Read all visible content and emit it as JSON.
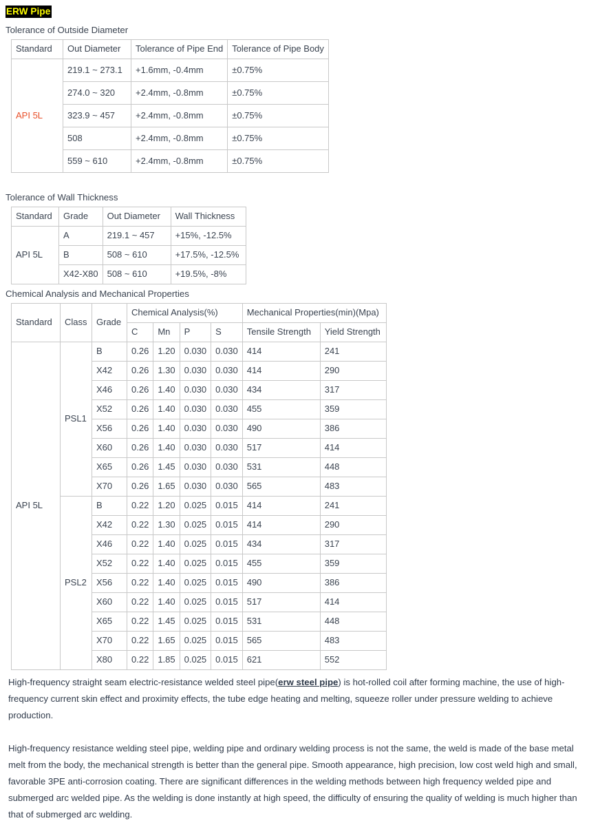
{
  "document": {
    "title": "ERW Pipe",
    "title_colors": {
      "background": "#000000",
      "text": "#ffff00"
    },
    "accent_red": "#e8502a"
  },
  "sections": {
    "outside_diameter": {
      "caption": "Tolerance of Outside Diameter",
      "columns": [
        "Standard",
        "Out Diameter",
        "Tolerance of Pipe End",
        "Tolerance of Pipe Body"
      ],
      "standard": "API 5L",
      "rows": [
        {
          "out_diameter": "219.1 ~ 273.1",
          "pipe_end": "+1.6mm, -0.4mm",
          "pipe_body": "±0.75%"
        },
        {
          "out_diameter": "274.0 ~ 320",
          "pipe_end": "+2.4mm, -0.8mm",
          "pipe_body": "±0.75%"
        },
        {
          "out_diameter": "323.9 ~ 457",
          "pipe_end": "+2.4mm, -0.8mm",
          "pipe_body": "±0.75%"
        },
        {
          "out_diameter": "508",
          "pipe_end": "+2.4mm, -0.8mm",
          "pipe_body": "±0.75%"
        },
        {
          "out_diameter": "559 ~ 610",
          "pipe_end": "+2.4mm, -0.8mm",
          "pipe_body": "±0.75%"
        }
      ]
    },
    "wall_thickness": {
      "caption": "Tolerance of Wall Thickness",
      "columns": [
        "Standard",
        "Grade",
        "Out Diameter",
        "Wall Thickness"
      ],
      "standard": "API 5L",
      "rows": [
        {
          "grade": "A",
          "out_diameter": "219.1 ~ 457",
          "wall_thickness": "+15%, -12.5%"
        },
        {
          "grade": "B",
          "out_diameter": "508 ~ 610",
          "wall_thickness": "+17.5%, -12.5%"
        },
        {
          "grade": "X42-X80",
          "out_diameter": "508 ~ 610",
          "wall_thickness": "+19.5%, -8%"
        }
      ]
    },
    "chem_mech": {
      "caption": "Chemical Analysis and Mechanical Properties",
      "col_standard": "Standard",
      "col_class": "Class",
      "col_grade": "Grade",
      "group_chemical": "Chemical Analysis(%)",
      "group_mechanical": "Mechanical Properties(min)(Mpa)",
      "sub_c": "C",
      "sub_mn": "Mn",
      "sub_p": "P",
      "sub_s": "S",
      "sub_tensile": "Tensile Strength",
      "sub_yield": "Yield Strength",
      "standard": "API 5L",
      "classes": [
        {
          "name": "PSL1",
          "rows": [
            {
              "grade": "B",
              "c": "0.26",
              "mn": "1.20",
              "p": "0.030",
              "s": "0.030",
              "tensile": "414",
              "yield": "241"
            },
            {
              "grade": "X42",
              "c": "0.26",
              "mn": "1.30",
              "p": "0.030",
              "s": "0.030",
              "tensile": "414",
              "yield": "290"
            },
            {
              "grade": "X46",
              "c": "0.26",
              "mn": "1.40",
              "p": "0.030",
              "s": "0.030",
              "tensile": "434",
              "yield": "317"
            },
            {
              "grade": "X52",
              "c": "0.26",
              "mn": "1.40",
              "p": "0.030",
              "s": "0.030",
              "tensile": "455",
              "yield": "359"
            },
            {
              "grade": "X56",
              "c": "0.26",
              "mn": "1.40",
              "p": "0.030",
              "s": "0.030",
              "tensile": "490",
              "yield": "386"
            },
            {
              "grade": "X60",
              "c": "0.26",
              "mn": "1.40",
              "p": "0.030",
              "s": "0.030",
              "tensile": "517",
              "yield": "414"
            },
            {
              "grade": "X65",
              "c": "0.26",
              "mn": "1.45",
              "p": "0.030",
              "s": "0.030",
              "tensile": "531",
              "yield": "448"
            },
            {
              "grade": "X70",
              "c": "0.26",
              "mn": "1.65",
              "p": "0.030",
              "s": "0.030",
              "tensile": "565",
              "yield": "483"
            }
          ]
        },
        {
          "name": "PSL2",
          "rows": [
            {
              "grade": "B",
              "c": "0.22",
              "mn": "1.20",
              "p": "0.025",
              "s": "0.015",
              "tensile": "414",
              "yield": "241"
            },
            {
              "grade": "X42",
              "c": "0.22",
              "mn": "1.30",
              "p": "0.025",
              "s": "0.015",
              "tensile": "414",
              "yield": "290"
            },
            {
              "grade": "X46",
              "c": "0.22",
              "mn": "1.40",
              "p": "0.025",
              "s": "0.015",
              "tensile": "434",
              "yield": "317"
            },
            {
              "grade": "X52",
              "c": "0.22",
              "mn": "1.40",
              "p": "0.025",
              "s": "0.015",
              "tensile": "455",
              "yield": "359"
            },
            {
              "grade": "X56",
              "c": "0.22",
              "mn": "1.40",
              "p": "0.025",
              "s": "0.015",
              "tensile": "490",
              "yield": "386"
            },
            {
              "grade": "X60",
              "c": "0.22",
              "mn": "1.40",
              "p": "0.025",
              "s": "0.015",
              "tensile": "517",
              "yield": "414"
            },
            {
              "grade": "X65",
              "c": "0.22",
              "mn": "1.45",
              "p": "0.025",
              "s": "0.015",
              "tensile": "531",
              "yield": "448"
            },
            {
              "grade": "X70",
              "c": "0.22",
              "mn": "1.65",
              "p": "0.025",
              "s": "0.015",
              "tensile": "565",
              "yield": "483"
            },
            {
              "grade": "X80",
              "c": "0.22",
              "mn": "1.85",
              "p": "0.025",
              "s": "0.015",
              "tensile": "621",
              "yield": "552"
            }
          ]
        }
      ]
    }
  },
  "paragraphs": [
    {
      "lead": "High-frequency straight seam electric-resistance welded steel pipe(",
      "link": "erw steel pipe",
      "tail": ") is hot-rolled coil after forming machine, the use of high-frequency current skin effect and proximity effects, the tube edge heating and melting, squeeze roller under pressure welding to achieve production."
    },
    {
      "text": "High-frequency resistance welding steel pipe, welding pipe and ordinary welding process is not the same, the weld is made of the base metal melt from the body, the mechanical strength is better than the general pipe. Smooth appearance, high precision, low cost weld high and small, favorable 3PE anti-corrosion coating. There are significant differences in the welding methods between high frequency welded pipe and submerged arc welded pipe. As the welding is done instantly at high speed, the difficulty of ensuring the quality of welding is much higher than that of submerged arc welding."
    }
  ]
}
